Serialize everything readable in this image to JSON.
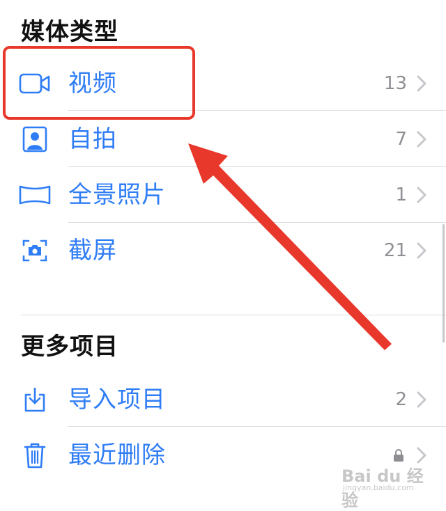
{
  "sections": {
    "media_types": {
      "title": "媒体类型",
      "items": [
        {
          "label": "视频",
          "count": "13",
          "icon": "video-icon"
        },
        {
          "label": "自拍",
          "count": "7",
          "icon": "selfie-portrait-icon"
        },
        {
          "label": "全景照片",
          "count": "1",
          "icon": "panorama-icon"
        },
        {
          "label": "截屏",
          "count": "21",
          "icon": "screenshot-icon"
        }
      ]
    },
    "more_items": {
      "title": "更多项目",
      "items": [
        {
          "label": "导入项目",
          "count": "2",
          "icon": "import-tray-icon"
        },
        {
          "label": "最近删除",
          "count": "",
          "icon": "trash-icon",
          "locked": true
        }
      ]
    }
  },
  "annotation": {
    "highlight_color": "#e8382c",
    "highlighted_item": "视频"
  },
  "watermark": {
    "main": "Bai du 经验",
    "sub": "jingyan.baidu.com"
  },
  "colors": {
    "accent": "#2f7df6",
    "count": "#8e8e93",
    "chevron": "#c7c7cc"
  }
}
